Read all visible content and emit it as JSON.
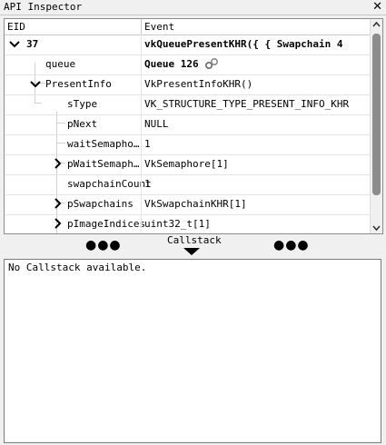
{
  "window": {
    "title": "API Inspector",
    "close_glyph": "✕"
  },
  "table": {
    "headers": {
      "eid": "EID",
      "event": "Event"
    },
    "rows": [
      {
        "name": "37",
        "value": "vkQueuePresentKHR({  {  Swapchain 4",
        "bold": true,
        "expanded": true
      },
      {
        "name": "queue",
        "value": "Queue 126",
        "value_bold": true,
        "has_link_icon": true
      },
      {
        "name": "PresentInfo",
        "value": "VkPresentInfoKHR()",
        "expanded": true
      },
      {
        "name": "sType",
        "value": "VK_STRUCTURE_TYPE_PRESENT_INFO_KHR"
      },
      {
        "name": "pNext",
        "value": "NULL"
      },
      {
        "name": "waitSemapho…",
        "value": "1"
      },
      {
        "name": "pWaitSemaph…",
        "value": "VkSemaphore[1]",
        "collapsed": true
      },
      {
        "name": "swapchainCount",
        "value": "1"
      },
      {
        "name": "pSwapchains",
        "value": "VkSwapchainKHR[1]",
        "collapsed": true
      },
      {
        "name": "pImageIndices",
        "value": "uint32_t[1]",
        "collapsed": true
      }
    ]
  },
  "splitter": {
    "label": "Callstack",
    "dots": "●●●"
  },
  "callstack": {
    "message": "No Callstack available."
  },
  "icons": {
    "close": "close-icon",
    "expand": "chevron-down-icon",
    "collapse": "chevron-right-icon",
    "link": "link-icon",
    "scroll_up": "scroll-up-icon",
    "scroll_down": "scroll-down-icon"
  },
  "colors": {
    "scroll_thumb": "#8c8c8c",
    "background": "#f0f0f0",
    "panel": "#ffffff"
  }
}
